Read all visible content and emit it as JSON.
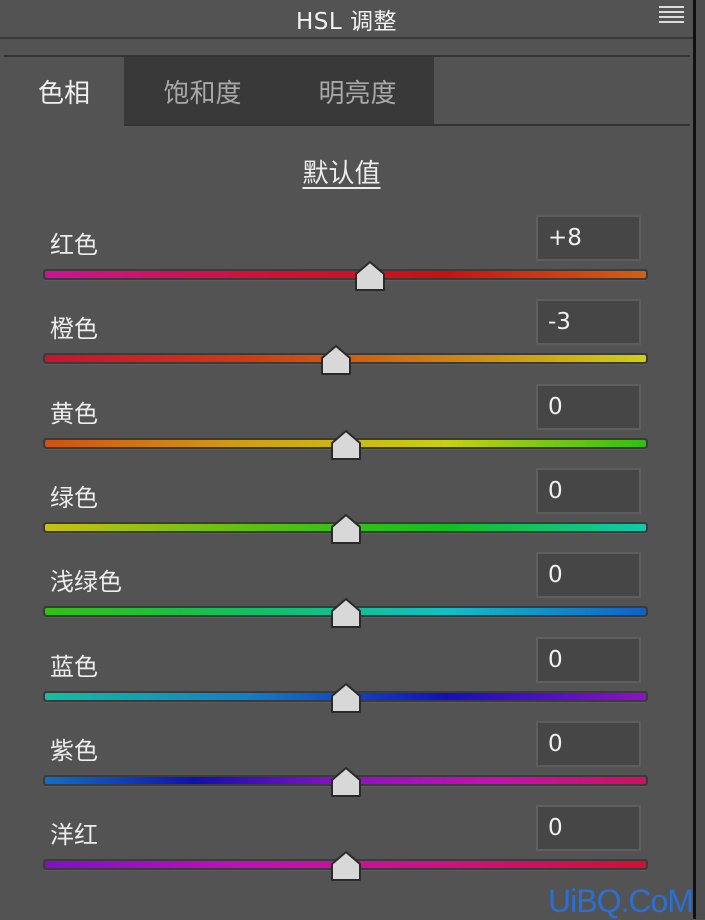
{
  "header": {
    "title": "HSL 调整",
    "menu_icon": "hamburger-menu-icon"
  },
  "tabs": [
    {
      "label": "色相",
      "active": true
    },
    {
      "label": "饱和度",
      "active": false
    },
    {
      "label": "明亮度",
      "active": false
    }
  ],
  "default_link": "默认值",
  "slider_range": [
    -100,
    100
  ],
  "sliders": [
    {
      "label": "红色",
      "value_text": "+8",
      "value": 8,
      "gradient": [
        "#d0109a",
        "#d4103a",
        "#cc1010",
        "#d46010"
      ]
    },
    {
      "label": "橙色",
      "value_text": "-3",
      "value": -3,
      "gradient": [
        "#cc1030",
        "#d03a10",
        "#d08010",
        "#d0d010"
      ]
    },
    {
      "label": "黄色",
      "value_text": "0",
      "value": 0,
      "gradient": [
        "#d05010",
        "#d0a010",
        "#c8d010",
        "#30c010"
      ]
    },
    {
      "label": "绿色",
      "value_text": "0",
      "value": 0,
      "gradient": [
        "#c8c010",
        "#60c010",
        "#10c020",
        "#10c8b0"
      ]
    },
    {
      "label": "浅绿色",
      "value_text": "0",
      "value": 0,
      "gradient": [
        "#30c010",
        "#10c060",
        "#10c0c8",
        "#1060c8"
      ]
    },
    {
      "label": "蓝色",
      "value_text": "0",
      "value": 0,
      "gradient": [
        "#10c0a0",
        "#1080c8",
        "#1010c0",
        "#9010c8"
      ]
    },
    {
      "label": "紫色",
      "value_text": "0",
      "value": 0,
      "gradient": [
        "#1070c8",
        "#1010b0",
        "#9010c8",
        "#c810b0",
        "#d01060"
      ]
    },
    {
      "label": "洋红",
      "value_text": "0",
      "value": 0,
      "gradient": [
        "#8010c8",
        "#c010b8",
        "#d01080",
        "#d01030"
      ]
    }
  ],
  "watermark": "UiBQ.CoM"
}
